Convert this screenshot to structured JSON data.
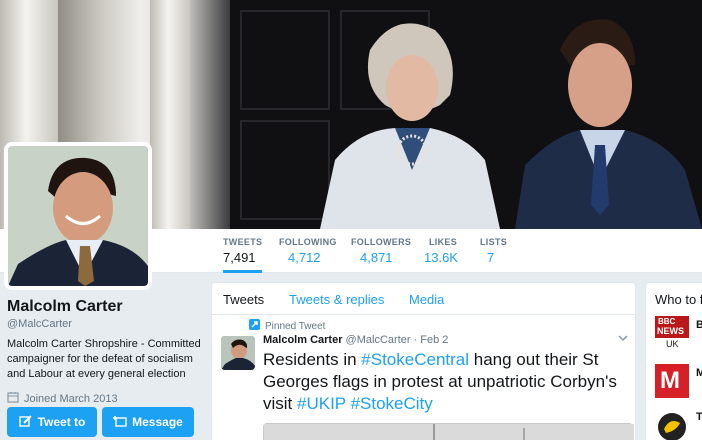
{
  "profile": {
    "name": "Malcolm Carter",
    "handle": "@MalcCarter",
    "bio": "Malcolm Carter Shropshire - Committed campaigner for the defeat of socialism and Labour at every general election",
    "joined": "Joined March 2013",
    "tweet_to_label": "Tweet to",
    "message_label": "Message"
  },
  "stats": [
    {
      "label": "TWEETS",
      "value": "7,491"
    },
    {
      "label": "FOLLOWING",
      "value": "4,712"
    },
    {
      "label": "FOLLOWERS",
      "value": "4,871"
    },
    {
      "label": "LIKES",
      "value": "13.6K"
    },
    {
      "label": "LISTS",
      "value": "7"
    }
  ],
  "tabs": [
    "Tweets",
    "Tweets & replies",
    "Media"
  ],
  "tweet": {
    "pinned_label": "Pinned Tweet",
    "author": "Malcolm Carter",
    "handle": "@MalcCarter",
    "sep": "·",
    "date": "Feb 2",
    "text_1": "Residents in ",
    "tag_1": "#StokeCentral",
    "text_2": " hang out their St Georges flags in protest at unpatriotic Corbyn's visit ",
    "tag_2": "#UKIP",
    "text_3": " ",
    "tag_3": "#StokeCity"
  },
  "who_to_follow": {
    "title": "Who to f",
    "items": [
      {
        "logo_top": "BBC",
        "logo_bottom": "NEWS",
        "caption": "UK",
        "initial": "B"
      },
      {
        "logo_top": "M",
        "caption": "",
        "initial": "M"
      },
      {
        "logo_top": "",
        "caption": "",
        "initial": "T"
      }
    ]
  },
  "colors": {
    "accent": "#1da1f2",
    "bbc_red": "#bb1919"
  }
}
